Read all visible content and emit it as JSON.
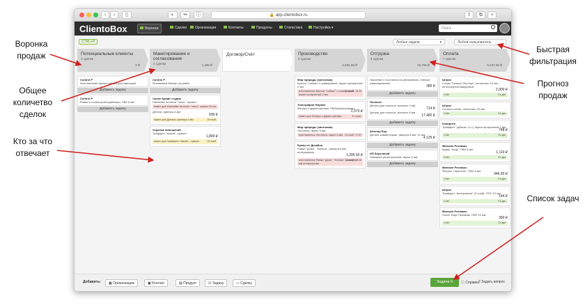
{
  "browser": {
    "url": "app.clientobox.ru"
  },
  "app": {
    "logo": "ClientoBox",
    "search_placeholder": "Поиск",
    "nav": [
      "Воронка",
      "Сделки",
      "Организации",
      "Контакты",
      "Продукты",
      "Статистика",
      "Настройка"
    ]
  },
  "toolbar": {
    "ctrl": "CTRL+P",
    "filter1": "Любые задачи",
    "filter2": "Любой пользователь"
  },
  "columns": [
    {
      "title": "Потенциальные клиенты",
      "count": "2 сделки",
      "sum": "0 ₽"
    },
    {
      "title": "Макетирование и согласование",
      "count": "4 сделки",
      "sum": "1,490 ₽"
    },
    {
      "title": "Договор/Счёт",
      "count": "",
      "sum": ""
    },
    {
      "title": "Производство",
      "count": "4 сделки",
      "sum": "5,565.50 ₽"
    },
    {
      "title": "Отгрузка",
      "count": "4 сделки",
      "sum": "22,786 ₽"
    },
    {
      "title": "Оплата",
      "count": "7 сделок",
      "sum": "6,247.50 ₽"
    }
  ],
  "add_task": "Добавить задачу",
  "cards": {
    "c1a": {
      "title": "Control P",
      "text": "Изготовление промо-набора для ювелиров"
    },
    "c1b": {
      "title": "Control P",
      "text": "Рамки и слова-промосувениры, ПВХ 8 мм"
    },
    "c2a": {
      "title": "Control P",
      "text": "Рекламный баннер на район"
    },
    "c2b": {
      "title": "Салон Крафт студия",
      "text": "Наклейки на капот \"часы\", оракал",
      "t1": "макет для Наклейки на капот \"часы\", оракал",
      "t1r": "15 окт.",
      "l1": "Детали, фанера 4 мм",
      "p1": "690 ₽",
      "t2": "макет для Детали, фанера 4 мм",
      "t2r": "15 нояб."
    },
    "c2c": {
      "title": "Отделка помещений",
      "text": "Трафарет \"мазня\", оракал",
      "price": "1,800 ₽",
      "t1": "макет для Трафарет \"мазня\", оракал",
      "t1r": "15 нояб."
    },
    "c4a": {
      "title": "Мир природы (заготовки)",
      "text": "Брелок \"собака\" с гравировкой, акрил прозрачный 2 мм",
      "t1": "изготовление Брелок \"собака\" с гравировкой, акрил прозрачный 2 мм",
      "t1r": "11 нояб. 15:25"
    },
    "c4b": {
      "title": "Типография Формат",
      "text": "Фигуры с двумя щитами, ПВХ/фанера/акрил",
      "price": "2,070 ₽",
      "t1": "макет для Фигуры с двумя щитами",
      "t1r": "11 нояб."
    },
    "c4c": {
      "title": "Мир природы (заготовки)",
      "text": "Логотипы, акрил 5 мм",
      "t1": "изготовление Логотипы, акрил 5 мм",
      "t1r": "15 нояб. 17:07"
    },
    "c4d": {
      "title": "Буквы от Дизайна",
      "text": "Рамки \"дома\", \"Ксения\", фанера 6 мм интерьерная",
      "price": "1,295.50 ₽",
      "t1": "изготовление Рамки \"дома\", \"Ксения\", фанера 6 мм интерьерная",
      "t1r": "11 нояб. 17:26"
    },
    "c5a": {
      "text": "Наклейки с логотипом на автомобиль, пленка/ламинирование",
      "price": "385 ₽"
    },
    "c5b": {
      "title": "Полоски",
      "text": "Детали для полосок, монолит 3 мм",
      "price": "714 ₽",
      "l2": "Детали для полосок, монолит 5 мм",
      "p2": "17,482 ₽"
    },
    "c5c": {
      "title": "Штопор Бор",
      "text": "Детали-комментарии, фанера 6 мм, 10 мм",
      "price": "4,125 ₽"
    },
    "c5d": {
      "title": "ИП Березиной",
      "text": "Лазерная резка деталей, акрил 5 мм"
    },
    "c6a": {
      "title": "Штрих",
      "text": "Слова \"Кольцо\" Восторг!, пенопласт 10 мм интерьерной кварцевый",
      "price": "2,900 ₽",
      "s": "Счёт",
      "sr": "01 дек."
    },
    "c6b": {
      "title": "Штрих",
      "text": "Слова в схеме, пенопласт 30 мм",
      "s": "Счёт",
      "sr": "01 дек."
    },
    "c6c": {
      "title": "Копирнек",
      "text": "Трафарет \"урбаны\" (x-т), акрил прозрачный 2 мм",
      "price": "748 ₽",
      "s": "Счёт",
      "sr": "01 дек."
    },
    "c6d": {
      "title": "Магазин Рекламы",
      "text": "Буквы \"вход\", ПВХ 8 мм",
      "price": "1,119 ₽",
      "s": "Счёт",
      "sr": "01 дек."
    },
    "c6e": {
      "title": "Магазин Рекламы",
      "text": "Фигуры \"горшочек\", ПВХ 8 мм",
      "price": "946.50 ₽",
      "s": "Счёт",
      "sr": "01 дек."
    },
    "c6f": {
      "title": "Штрих",
      "text": "Трафарет \"волнушечки\" (3 слой), ПЭТ 0,5 мм",
      "price": "144 ₽",
      "s": "Счёт",
      "sr": "01 дек."
    },
    "c6g": {
      "title": "Магазин Рекламы",
      "text": "Хлыст Барс Премиум, ПВХ 10 мм",
      "price": "390 ₽",
      "s": "Счёт",
      "sr": "01 дек."
    }
  },
  "bottom": {
    "add_label": "Добавить:",
    "buttons": [
      "Организацию",
      "Контакт",
      "Продукт",
      "Задачу",
      "Сделку"
    ],
    "tasks": "Задачи  0",
    "help": "Справка",
    "ask": "Задать вопрос"
  },
  "annotations": {
    "a1": "Воронка продаж",
    "a2": "Общее количетво сделок",
    "a3": "Кто за что отвечает",
    "a4": "Быстрая фильтрация",
    "a5": "Прогноз продаж",
    "a6": "Список задач"
  },
  "colors": {
    "accent": "#5aa53a",
    "nav": "#2d2d2d",
    "arrow": "#d01e1e"
  }
}
